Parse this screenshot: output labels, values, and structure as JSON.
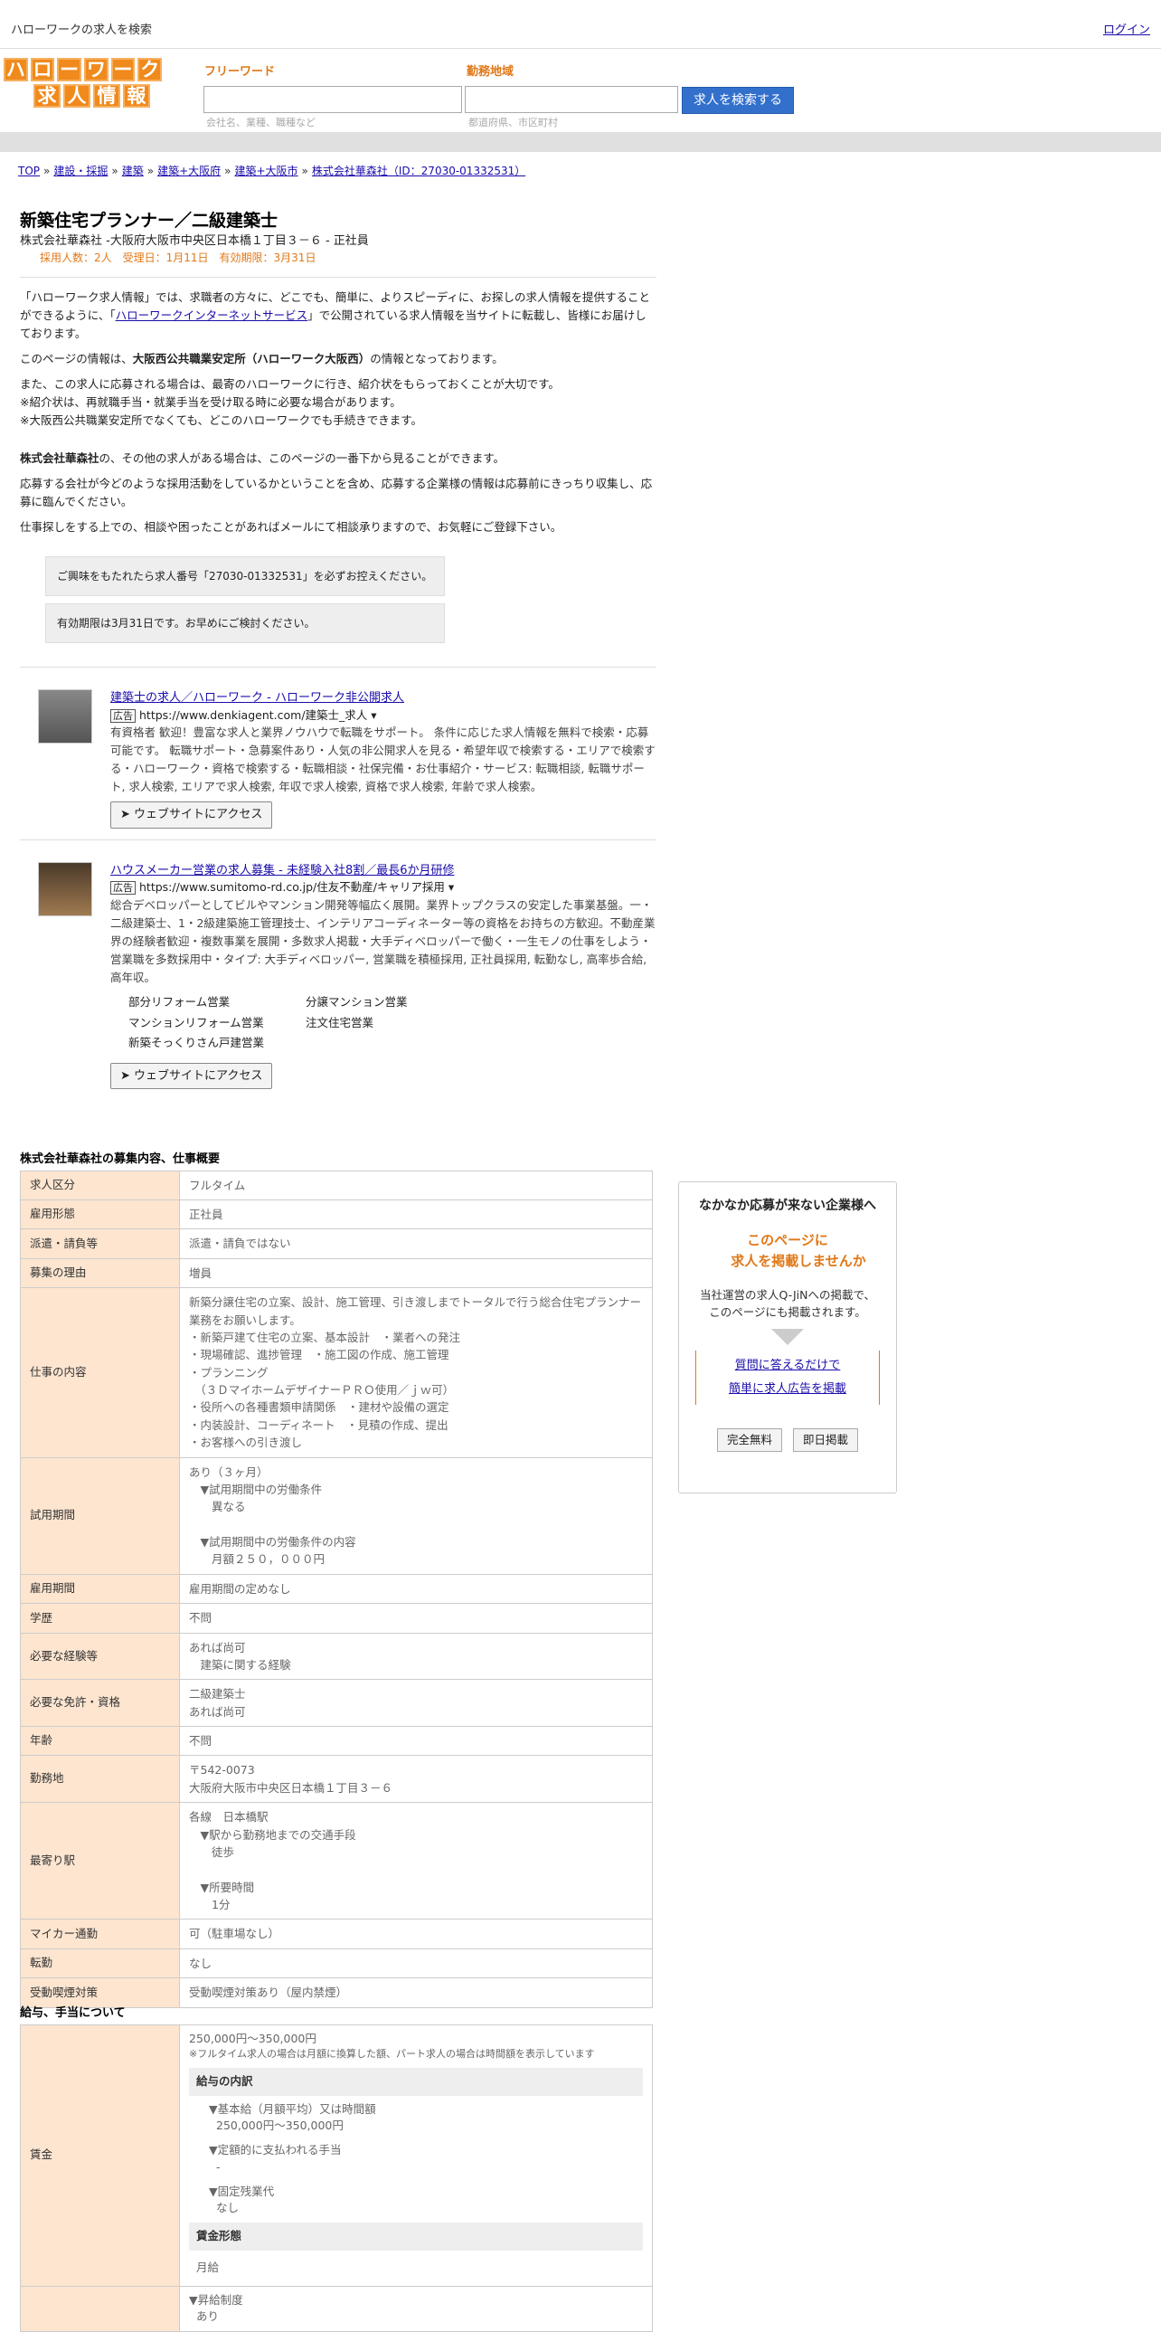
{
  "topbar": {
    "title": "ハローワークの求人を検索",
    "login": "ログイン"
  },
  "logo": {
    "row1": [
      "ハ",
      "ロ",
      "ー",
      "ワ",
      "ー",
      "ク"
    ],
    "row2": [
      "求",
      "人",
      "情",
      "報"
    ]
  },
  "search": {
    "free_label": "フリーワード",
    "free_placeholder": "会社名、業種、職種など",
    "area_label": "勤務地域",
    "area_placeholder": "都道府県、市区町村",
    "button": "求人を検索する"
  },
  "breadcrumb": [
    "TOP",
    "建設・採掘",
    "建築",
    "建築+大阪府",
    "建築+大阪市",
    "株式会社華森社（ID：27030-01332531）"
  ],
  "job": {
    "title": "新築住宅プランナー／二級建築士",
    "subtitle": "株式会社華森社 -大阪府大阪市中央区日本橋１丁目３－６ - 正社員",
    "meta": "採用人数：2人　受理日：1月11日　有効期限：3月31日"
  },
  "intro": {
    "p1a": "「ハローワーク求人情報」では、求職者の方々に、どこでも、簡単に、よりスピーディに、お探しの求人情報を提供することができるように、「",
    "p1link": "ハローワークインターネットサービス",
    "p1b": "」で公開されている求人情報を当サイトに転載し、皆様にお届けしております。",
    "p2a": "このページの情報は、",
    "p2b": "大阪西公共職業安定所（ハローワーク大阪西）",
    "p2c": "の情報となっております。",
    "p3l1": "また、この求人に応募される場合は、最寄のハローワークに行き、紹介状をもらっておくことが大切です。",
    "p3l2": "※紹介状は、再就職手当・就業手当を受け取る時に必要な場合があります。",
    "p3l3": "※大阪西公共職業安定所でなくても、どこのハローワークでも手続きできます。",
    "p4a": "株式会社華森社",
    "p4b": "の、その他の求人がある場合は、このページの一番下から見ることができます。",
    "p5": "応募する会社が今どのような採用活動をしているかということを含め、応募する企業様の情報は応募前にきっちり収集し、応募に臨んでください。",
    "p6": "仕事探しをする上での、相談や困ったことがあればメールにて相談承りますので、お気軽にご登録下さい。"
  },
  "notes": {
    "n1": "ご興味をもたれたら求人番号「27030-01332531」を必ずお控えください。",
    "n2": "有効期限は3月31日です。お早めにご検討ください。"
  },
  "ads": [
    {
      "title": "建築士の求人／ハローワーク - ハローワーク非公開求人",
      "badge": "広告",
      "url": "https://www.denkiagent.com/建築士_求人 ▾",
      "desc": "有資格者 歓迎！豊富な求人と業界ノウハウで転職をサポート。 条件に応じた求人情報を無料で検索・応募可能です。 転職サポート・急募案件あり・人気の非公開求人を見る・希望年収で検索する・エリアで検索する・ハローワーク・資格で検索する・転職相談・社保完備・お仕事紹介・サービス: 転職相談, 転職サポート, 求人検索, エリアで求人検索, 年収で求人検索, 資格で求人検索, 年齢で求人検索。",
      "button": "➤ ウェブサイトにアクセス"
    },
    {
      "title": "ハウスメーカー営業の求人募集 - 未経験入社8割／最長6か月研修",
      "badge": "広告",
      "url": "https://www.sumitomo-rd.co.jp/住友不動産/キャリア採用 ▾",
      "desc": "総合デベロッパーとしてビルやマンション開発等幅広く展開。業界トップクラスの安定した事業基盤。一・二級建築士、1・2級建築施工管理技士、インテリアコーディネーター等の資格をお持ちの方歓迎。不動産業界の経験者歓迎・複数事業を展開・多数求人掲載・大手ディベロッパーで働く・一生モノの仕事をしよう・営業職を多数採用中・タイプ: 大手ディベロッパー, 営業職を積極採用, 正社員採用, 転勤なし, 高率歩合給, 高年収。",
      "links": [
        "部分リフォーム営業",
        "分譲マンション営業",
        "マンションリフォーム営業",
        "注文住宅営業",
        "新築そっくりさん戸建営業"
      ],
      "button": "➤ ウェブサイトにアクセス"
    }
  ],
  "section1": "株式会社華森社の募集内容、仕事概要",
  "rows": [
    {
      "k": "求人区分",
      "v": "フルタイム"
    },
    {
      "k": "雇用形態",
      "v": "正社員"
    },
    {
      "k": "派遣・請負等",
      "v": "派遣・請負ではない"
    },
    {
      "k": "募集の理由",
      "v": "増員"
    },
    {
      "k": "仕事の内容",
      "v": "新築分譲住宅の立案、設計、施工管理、引き渡しまでトータルで行う総合住宅プランナー業務をお願いします。\n・新築戸建て住宅の立案、基本設計　・業者への発注\n・現場確認、進捗管理　・施工図の作成、施工管理\n・プランニング\n　（３ＤマイホームデザイナーＰＲＯ使用／ｊｗ可）\n・役所への各種書類申請関係　・建材や設備の選定\n・内装設計、コーディネート　・見積の作成、提出\n・お客様への引き渡し"
    },
    {
      "k": "試用期間",
      "v": "あり（３ヶ月）\n　▼試用期間中の労働条件\n　　異なる\n\n　▼試用期間中の労働条件の内容\n　　月額２５０，０００円"
    },
    {
      "k": "雇用期間",
      "v": "雇用期間の定めなし"
    },
    {
      "k": "学歴",
      "v": "不問"
    },
    {
      "k": "必要な経験等",
      "v": "あれば尚可\n　建築に関する経験"
    },
    {
      "k": "必要な免許・資格",
      "v": "二級建築士\nあれば尚可"
    },
    {
      "k": "年齢",
      "v": "不問"
    },
    {
      "k": "勤務地",
      "v": "〒542-0073\n大阪府大阪市中央区日本橋１丁目３－６"
    },
    {
      "k": "最寄り駅",
      "v": "各線　日本橋駅\n　▼駅から勤務地までの交通手段\n　　徒歩\n\n　▼所要時間\n　　1分"
    },
    {
      "k": "マイカー通勤",
      "v": "可（駐車場なし）"
    },
    {
      "k": "転勤",
      "v": "なし"
    },
    {
      "k": "受動喫煙対策",
      "v": "受動喫煙対策あり（屋内禁煙）"
    }
  ],
  "side": {
    "heading": "なかなか応募が来ない企業様へ",
    "offer_l1": "このページに",
    "offer_l2": "求人を掲載しませんか",
    "desc_l1": "当社運営の求人Q-JiNへの掲載で、",
    "desc_l2": "このページにも掲載されます。",
    "link1": "質問に答えるだけで",
    "link2": "簡単に求人広告を掲載",
    "btn1": "完全無料",
    "btn2": "即日掲載"
  },
  "section2": "給与、手当について",
  "pay": {
    "k": "賃金",
    "range": "250,000円〜350,000円",
    "note": "※フルタイム求人の場合は月額に換算した額、パート求人の場合は時間額を表示しています",
    "bar1": "給与の内訳",
    "i1": "▼基本給（月額平均）又は時間額",
    "i1v": "250,000円〜350,000円",
    "i2": "▼定額的に支払われる手当",
    "i2v": "-",
    "i3": "▼固定残業代",
    "i3v": "なし",
    "bar2": "賃金形態",
    "form": "月給",
    "raise": "▼昇給制度",
    "raisev": "あり"
  }
}
